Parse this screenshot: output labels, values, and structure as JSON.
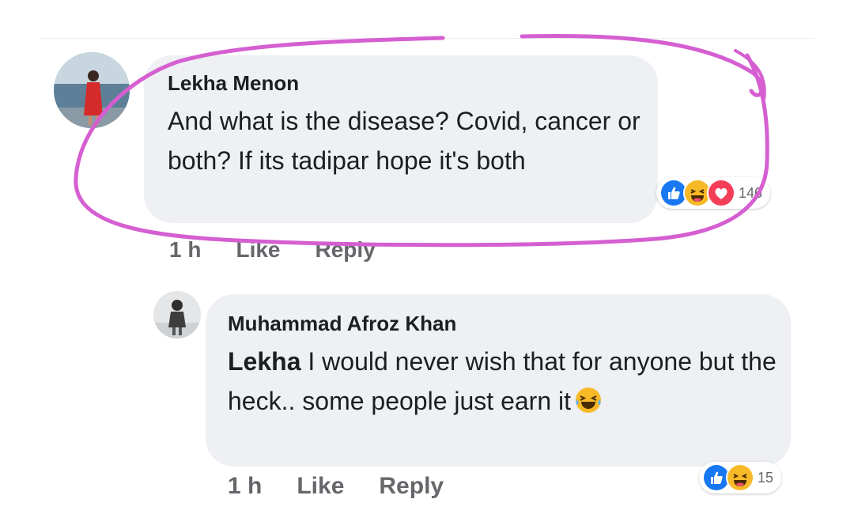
{
  "comments": [
    {
      "author": "Lekha Menon",
      "text": "And what is the disease? Covid, cancer or both? If its tadipar hope it's both",
      "time": "1 h",
      "like_label": "Like",
      "reply_label": "Reply",
      "reaction_count": "146",
      "reactions": [
        "like-icon",
        "haha-icon",
        "love-icon"
      ]
    },
    {
      "author": "Muhammad Afroz Khan",
      "mention": "Lekha",
      "text": " I would never wish that for anyone but the heck.. some people just earn it",
      "time": "1 h",
      "like_label": "Like",
      "reply_label": "Reply",
      "reaction_count": "15",
      "reactions": [
        "like-icon",
        "haha-icon"
      ],
      "inline_emoji": "laughing-emoji"
    }
  ],
  "colors": {
    "bubble": "#eef0f3",
    "meta_text": "#65676b",
    "like_blue": "#1877f2",
    "love_red": "#f33e58",
    "haha_yellow": "#f7b928",
    "annotation": "#d55fd1"
  }
}
